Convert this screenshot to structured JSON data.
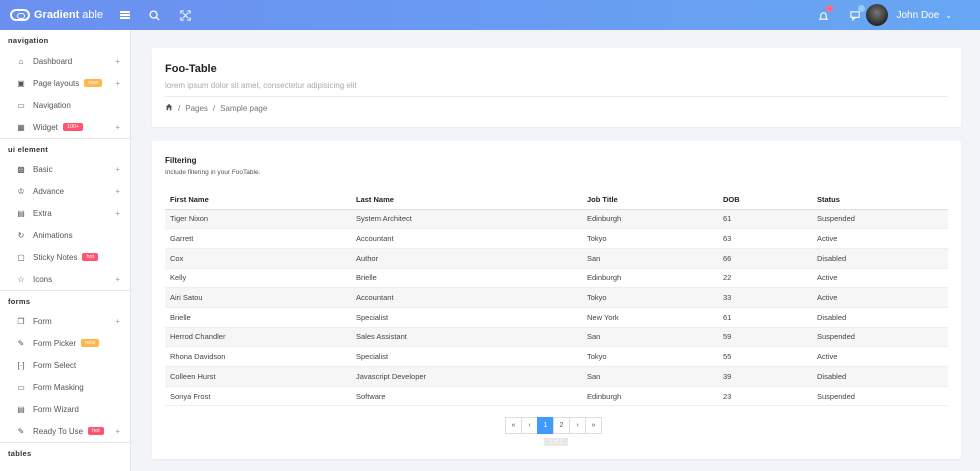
{
  "topbar": {
    "brand_bold": "Gradient",
    "brand_light": " able",
    "user_name": "John Doe"
  },
  "sidebar": {
    "sections": [
      {
        "title": "navigation"
      },
      {
        "title": "ui element"
      },
      {
        "title": "forms"
      },
      {
        "title": "tables"
      }
    ],
    "items": [
      {
        "label": "Dashboard",
        "icon": "home-icon"
      },
      {
        "label": "Page layouts",
        "icon": "layout-icon",
        "tag": "new"
      },
      {
        "label": "Navigation",
        "icon": "sidebar-icon"
      },
      {
        "label": "Widget",
        "icon": "grid-icon",
        "tag": "100+"
      },
      {
        "label": "Basic",
        "icon": "box-icon"
      },
      {
        "label": "Advance",
        "icon": "crown-icon"
      },
      {
        "label": "Extra",
        "icon": "gift-icon"
      },
      {
        "label": "Animations",
        "icon": "refresh-icon"
      },
      {
        "label": "Sticky Notes",
        "icon": "clipboard-icon",
        "tag": "hot"
      },
      {
        "label": "Icons",
        "icon": "star-icon"
      },
      {
        "label": "Form",
        "icon": "copy-icon"
      },
      {
        "label": "Form Picker",
        "icon": "edit-icon",
        "tag": "new"
      },
      {
        "label": "Form Select",
        "icon": "bracket-icon"
      },
      {
        "label": "Form Masking",
        "icon": "credit-card-icon"
      },
      {
        "label": "Form Wizard",
        "icon": "archive-icon"
      },
      {
        "label": "Ready To Use",
        "icon": "edit-square-icon",
        "tag": "hot"
      }
    ]
  },
  "page_header": {
    "title": "Foo-Table",
    "subtitle": "lorem ipsum dolor sit amet, consectetur adipisicing elit",
    "breadcrumb": [
      "Pages",
      "Sample page"
    ]
  },
  "table_card": {
    "title": "Filtering",
    "subtitle": "Include filtering in your FooTable.",
    "columns": [
      "First Name",
      "Last Name",
      "Job Title",
      "DOB",
      "Status"
    ],
    "rows": [
      [
        "Tiger Nixon",
        "System Architect",
        "Edinburgh",
        "61",
        "Suspended"
      ],
      [
        "Garrett",
        "Accountant",
        "Tokyo",
        "63",
        "Active"
      ],
      [
        "Cox",
        "Author",
        "San",
        "66",
        "Disabled"
      ],
      [
        "Kelly",
        "Brielle",
        "Edinburgh",
        "22",
        "Active"
      ],
      [
        "Airi Satou",
        "Accountant",
        "Tokyo",
        "33",
        "Active"
      ],
      [
        "Brielle",
        "Specialist",
        "New York",
        "61",
        "Disabled"
      ],
      [
        "Herrod Chandler",
        "Sales Assistant",
        "San",
        "59",
        "Suspended"
      ],
      [
        "Rhona Davidson",
        "Specialist",
        "Tokyo",
        "55",
        "Active"
      ],
      [
        "Colleen Hurst",
        "Javascript Developer",
        "San",
        "39",
        "Disabled"
      ],
      [
        "Sonya Frost",
        "Software",
        "Edinburgh",
        "23",
        "Suspended"
      ]
    ],
    "pagination": [
      "«",
      "‹",
      "1",
      "2",
      "›",
      "»"
    ],
    "active_page": "1",
    "page_info": "1 of 2"
  },
  "colors": {
    "topbar_start": "#6a8ff0",
    "topbar_end": "#67a7f3",
    "accent": "#4099ff",
    "tag_new": "#ffb64d",
    "tag_hot": "#ff5370"
  }
}
